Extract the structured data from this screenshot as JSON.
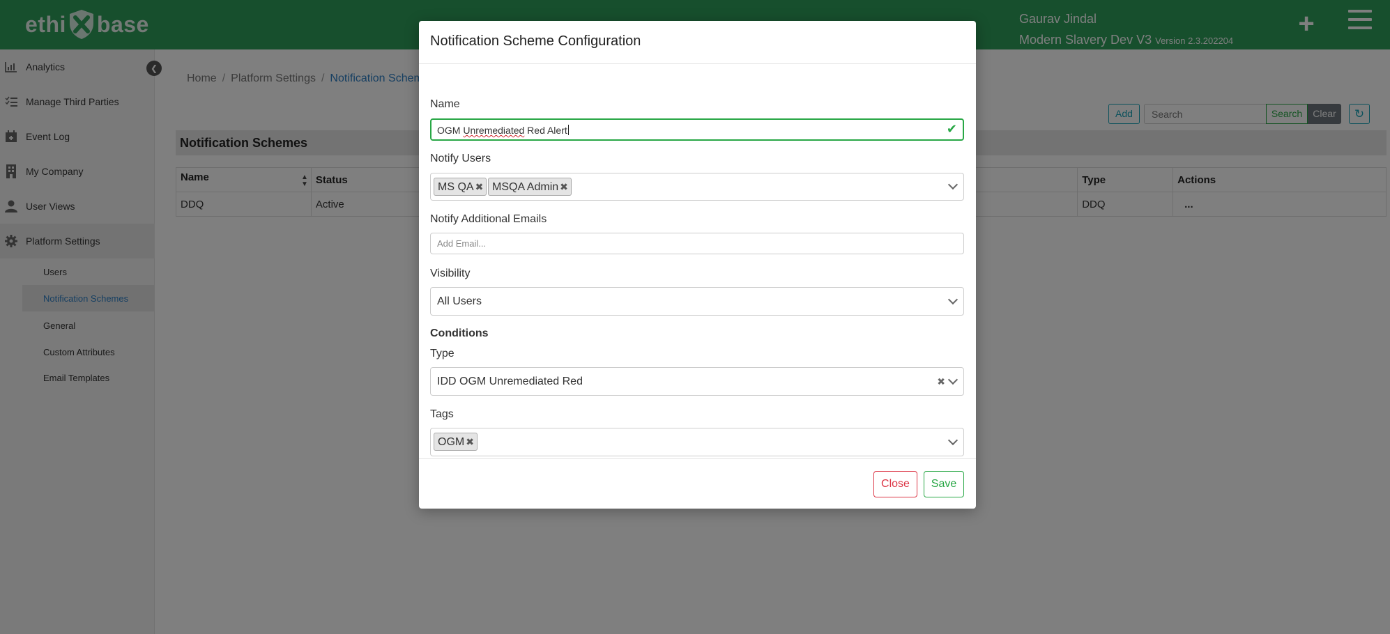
{
  "header": {
    "logo_text_left": "ethi",
    "logo_text_right": "base",
    "user_name": "Gaurav Jindal",
    "environment": "Modern Slavery Dev V3",
    "version": "Version 2.3.202204",
    "plus_icon": "plus-icon",
    "menu_icon": "hamburger-menu-icon"
  },
  "sidebar": {
    "items": [
      {
        "label": "Analytics",
        "icon": "bar-chart-icon"
      },
      {
        "label": "Manage Third Parties",
        "icon": "list-icon"
      },
      {
        "label": "Event Log",
        "icon": "calendar-icon"
      },
      {
        "label": "My Company",
        "icon": "building-icon"
      },
      {
        "label": "User Views",
        "icon": "user-icon"
      },
      {
        "label": "Platform Settings",
        "icon": "gear-icon"
      }
    ],
    "sub_items": [
      {
        "label": "Users"
      },
      {
        "label": "Notification Schemes"
      },
      {
        "label": "General"
      },
      {
        "label": "Custom Attributes"
      },
      {
        "label": "Email Templates"
      }
    ]
  },
  "breadcrumb": {
    "home": "Home",
    "settings": "Platform Settings",
    "current": "Notification Scheme"
  },
  "toolbar": {
    "add_label": "Add",
    "search_placeholder": "Search",
    "search_label": "Search",
    "clear_label": "Clear"
  },
  "table": {
    "title": "Notification Schemes",
    "columns": [
      "Name",
      "Status",
      "Type",
      "Actions"
    ],
    "rows": [
      {
        "name": "DDQ",
        "status": "Active",
        "type": "DDQ",
        "actions": "..."
      }
    ]
  },
  "modal": {
    "title": "Notification Scheme Configuration",
    "name_label": "Name",
    "name_value_prefix": "OGM ",
    "name_value_misspelled": "Unremediated",
    "name_value_suffix": " Red Alert",
    "notify_users_label": "Notify Users",
    "notify_users": [
      "MS QA",
      "MSQA Admin"
    ],
    "emails_label": "Notify Additional Emails",
    "emails_placeholder": "Add Email...",
    "visibility_label": "Visibility",
    "visibility_value": "All Users",
    "conditions_label": "Conditions",
    "type_label": "Type",
    "type_value": "IDD OGM Unremediated Red",
    "tags_label": "Tags",
    "tags": [
      "OGM"
    ],
    "close_label": "Close",
    "save_label": "Save"
  },
  "colors": {
    "brand_green": "#2e9e5b",
    "link_blue": "#2d7ec4",
    "danger": "#dc3545",
    "success": "#28a745",
    "info": "#17a2b8"
  }
}
